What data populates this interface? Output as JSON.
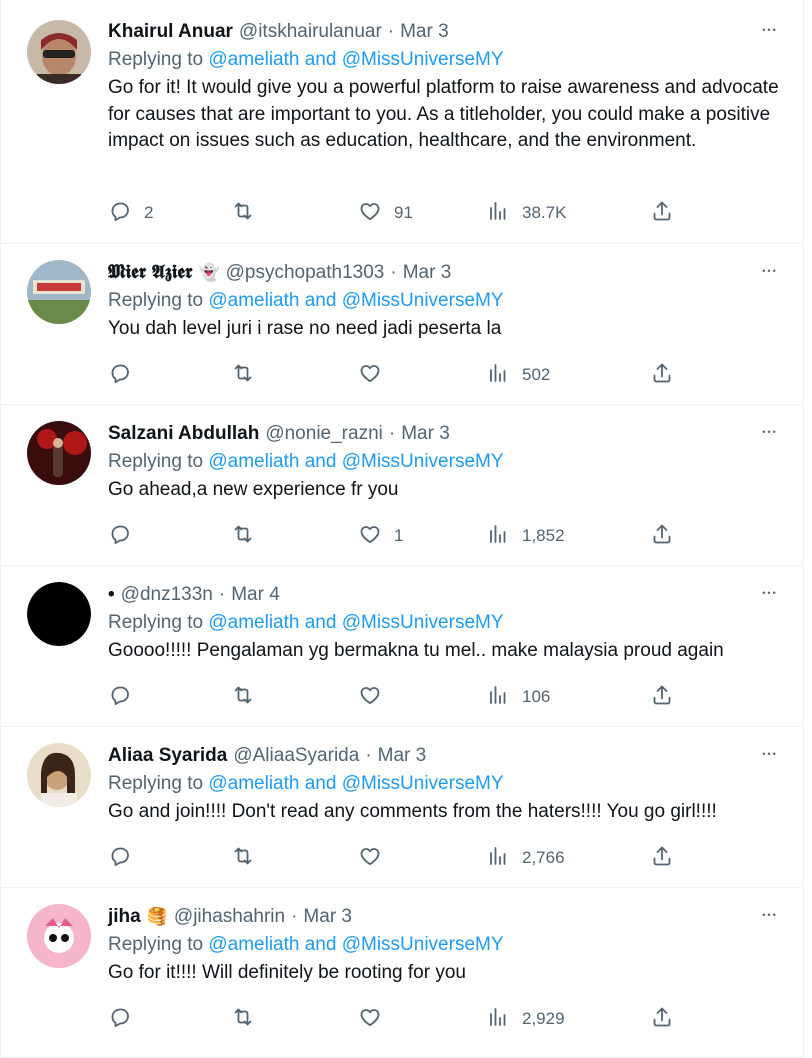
{
  "replying_to_label": "Replying to",
  "mention_text": "@ameliath and @MissUniverseMY",
  "tweets": [
    {
      "name": "Khairul Anuar",
      "handle": "@itskhairulanuar",
      "sep": "·",
      "date": "Mar 3",
      "text": "Go for it! It would give you a powerful platform to raise awareness and advocate for causes that are important to you. As a titleholder, you could make a positive impact on issues such as education, healthcare, and the environment.",
      "replies": "2",
      "retweets": "",
      "likes": "91",
      "views": "38.7K",
      "avatar_colors": [
        "#8a2a2a",
        "#3a2a28"
      ]
    },
    {
      "name": "𝕸𝖎𝖊𝖗 𝕬𝖟𝖎𝖊𝖗",
      "emoji": "👻",
      "handle": "@psychopath1303",
      "sep": "·",
      "date": "Mar 3",
      "text": "You dah level juri i rase no need jadi peserta la",
      "replies": "",
      "retweets": "",
      "likes": "",
      "views": "502",
      "avatar_colors": [
        "#9fb7c9",
        "#6a8a4a"
      ]
    },
    {
      "name": "Salzani Abdullah",
      "handle": "@nonie_razni",
      "sep": "·",
      "date": "Mar 3",
      "text": "Go ahead,a new experience fr you",
      "replies": "",
      "retweets": "",
      "likes": "1",
      "views": "1,852",
      "avatar_colors": [
        "#b01818",
        "#3a0d0d"
      ]
    },
    {
      "name": "•",
      "handle": "@dnz133n",
      "sep": "·",
      "date": "Mar 4",
      "text": "Goooo!!!!! Pengalaman yg bermakna tu mel.. make malaysia proud again",
      "replies": "",
      "retweets": "",
      "likes": "",
      "views": "106",
      "avatar_colors": [
        "#000000",
        "#000000"
      ]
    },
    {
      "name": "Aliaa Syarida",
      "handle": "@AliaaSyarida",
      "sep": "·",
      "date": "Mar 3",
      "text": "Go and join!!!! Don't read any comments from the haters!!!! You go girl!!!!",
      "replies": "",
      "retweets": "",
      "likes": "",
      "views": "2,766",
      "avatar_colors": [
        "#c9a27a",
        "#3b2418"
      ]
    },
    {
      "name": "jiha",
      "emoji": "🥞",
      "handle": "@jihashahrin",
      "sep": "·",
      "date": "Mar 3",
      "text": "Go for it!!!! Will definitely be rooting for you",
      "replies": "",
      "retweets": "",
      "likes": "",
      "views": "2,929",
      "avatar_colors": [
        "#f4b6c8",
        "#e25d8e"
      ]
    }
  ]
}
